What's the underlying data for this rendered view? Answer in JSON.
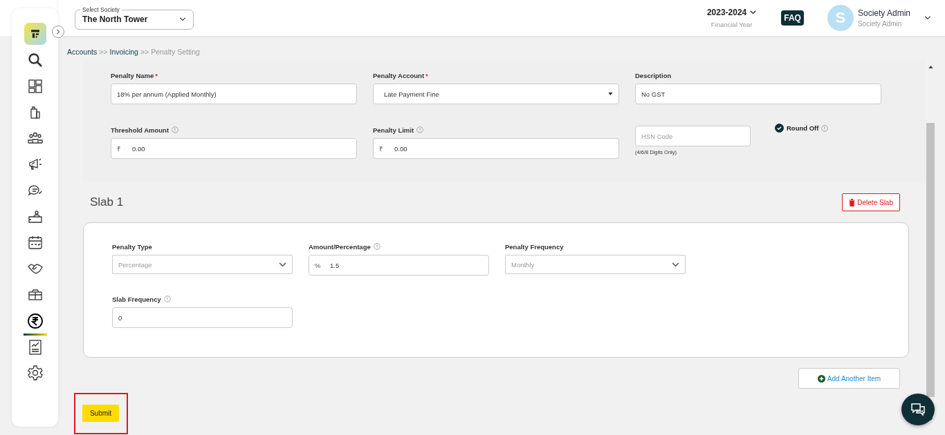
{
  "society_select": {
    "label": "Select Society",
    "value": "The North Tower"
  },
  "financial_year": {
    "value": "2023-2024",
    "caption": "Financial Year"
  },
  "faq": "FAQ",
  "user": {
    "initial": "S",
    "name": "Society Admin",
    "role": "Society Admin"
  },
  "sidebar": {
    "items": [
      {
        "kind": "search",
        "selected": false
      },
      {
        "kind": "dashboard",
        "selected": false
      },
      {
        "kind": "building",
        "selected": false
      },
      {
        "kind": "people",
        "selected": false
      },
      {
        "kind": "megaphone",
        "selected": false
      },
      {
        "kind": "chat",
        "selected": false
      },
      {
        "kind": "desk",
        "selected": false
      },
      {
        "kind": "calendar",
        "selected": false
      },
      {
        "kind": "handshake",
        "selected": false
      },
      {
        "kind": "box",
        "selected": false
      },
      {
        "kind": "rupee",
        "selected": true
      },
      {
        "kind": "report",
        "selected": false
      },
      {
        "kind": "settings",
        "selected": false
      }
    ]
  },
  "breadcrumb": {
    "separator": ">>",
    "items": [
      {
        "label": "Accounts",
        "current": false
      },
      {
        "label": "Invoicing",
        "current": false
      },
      {
        "label": "Penalty Setting",
        "current": true
      }
    ]
  },
  "penalty_form": {
    "rows": [
      [
        {
          "kind": "text",
          "label": "Penalty Name",
          "required_mark": "*",
          "info": false,
          "value": "18% per annum (Applied Monthly)"
        },
        {
          "kind": "account-select",
          "label": "Penalty Account",
          "required_mark": "*",
          "info": false,
          "value": "Late Payment Fine"
        },
        {
          "kind": "text",
          "label": "Description",
          "info": false,
          "value": "No GST"
        }
      ],
      [
        {
          "kind": "prefix",
          "label": "Threshold Amount",
          "info": true,
          "prefix": "₹",
          "value": "0.00"
        },
        {
          "kind": "prefix",
          "label": "Penalty Limit",
          "info": true,
          "prefix": "₹",
          "value": "0.00"
        },
        {
          "kind": "hint",
          "placeholder": "HSN Code",
          "hint": "(4/6/8 Digits Only)"
        }
      ]
    ],
    "round_off": {
      "label": "Round Off",
      "checked": true,
      "info": true
    }
  },
  "slab": {
    "title": "Slab 1",
    "delete_label": "Delete Slab",
    "rows": [
      [
        {
          "kind": "select",
          "label": "Penalty Type",
          "info": false,
          "value": "Percentage"
        },
        {
          "kind": "prefix",
          "label": "Amount/Percentage",
          "info": true,
          "prefix": "%",
          "value": "1.5"
        },
        {
          "kind": "select",
          "label": "Penalty Frequency",
          "info": false,
          "value": "Monthly"
        }
      ],
      [
        {
          "kind": "text",
          "label": "Slab Frequency",
          "info": true,
          "value": "0"
        }
      ]
    ]
  },
  "add_item": "Add Another Item",
  "submit": {
    "label": "Submit",
    "highlighted": true
  }
}
